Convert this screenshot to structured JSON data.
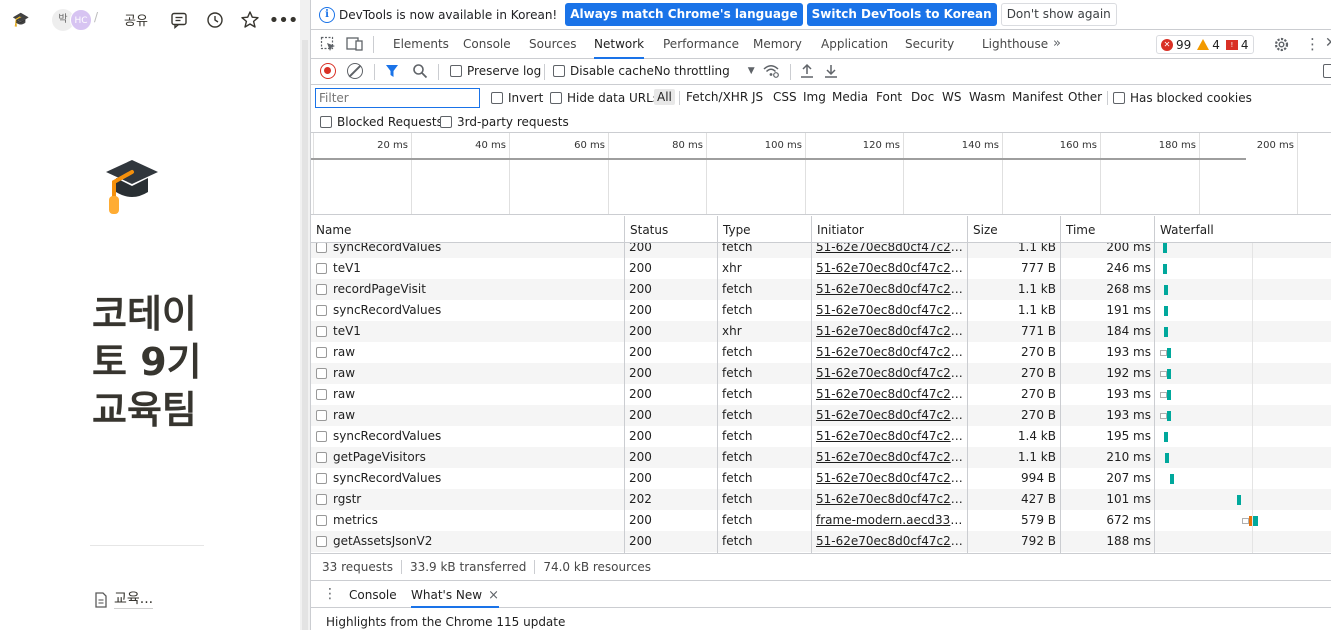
{
  "notion": {
    "page_icon_small": "🎓",
    "avatars": [
      "박",
      "HC"
    ],
    "share_label": "공유",
    "page_title": "코테이토 9기 교육팀",
    "subpage_label": "교육...",
    "icons": [
      "graduation-cap-icon",
      "comment-icon",
      "history-icon",
      "star-icon",
      "more-icon",
      "page-doc-icon"
    ]
  },
  "infobar": {
    "text": "DevTools is now available in Korean!",
    "btn_match": "Always match Chrome's language",
    "btn_switch": "Switch DevTools to Korean",
    "btn_dismiss": "Don't show again"
  },
  "tabs": [
    {
      "label": "Elements"
    },
    {
      "label": "Console"
    },
    {
      "label": "Sources"
    },
    {
      "label": "Network"
    },
    {
      "label": "Performance"
    },
    {
      "label": "Memory"
    },
    {
      "label": "Application"
    },
    {
      "label": "Security"
    },
    {
      "label": "Lighthouse"
    }
  ],
  "active_tab": "Network",
  "more_tabs": "»",
  "issues": {
    "errors": "99",
    "warnings": "4",
    "issues": "4"
  },
  "toolbar": {
    "preserve_log": "Preserve log",
    "disable_cache": "Disable cache",
    "throttling": "No throttling"
  },
  "filter": {
    "placeholder": "Filter",
    "invert": "Invert",
    "hide_data_urls": "Hide data URLs",
    "types": [
      "All",
      "Fetch/XHR",
      "JS",
      "CSS",
      "Img",
      "Media",
      "Font",
      "Doc",
      "WS",
      "Wasm",
      "Manifest",
      "Other"
    ],
    "has_blocked_cookies": "Has blocked cookies",
    "blocked_requests": "Blocked Requests",
    "third_party": "3rd-party requests"
  },
  "overview": {
    "ticks": [
      "20 ms",
      "40 ms",
      "60 ms",
      "80 ms",
      "100 ms",
      "120 ms",
      "140 ms",
      "160 ms",
      "180 ms",
      "200 ms"
    ]
  },
  "columns": [
    "Name",
    "Status",
    "Type",
    "Initiator",
    "Size",
    "Time",
    "Waterfall"
  ],
  "requests": [
    {
      "name": "syncRecordValues",
      "status": "200",
      "type": "fetch",
      "initiator": "51-62e70ec8d0cf47c2.js:1",
      "size": "1.1 kB",
      "time": "200 ms"
    },
    {
      "name": "teV1",
      "status": "200",
      "type": "xhr",
      "initiator": "51-62e70ec8d0cf47c2.js:1",
      "size": "777 B",
      "time": "246 ms"
    },
    {
      "name": "recordPageVisit",
      "status": "200",
      "type": "fetch",
      "initiator": "51-62e70ec8d0cf47c2.js:1",
      "size": "1.1 kB",
      "time": "268 ms"
    },
    {
      "name": "syncRecordValues",
      "status": "200",
      "type": "fetch",
      "initiator": "51-62e70ec8d0cf47c2.js:1",
      "size": "1.1 kB",
      "time": "191 ms"
    },
    {
      "name": "teV1",
      "status": "200",
      "type": "xhr",
      "initiator": "51-62e70ec8d0cf47c2.js:1",
      "size": "771 B",
      "time": "184 ms"
    },
    {
      "name": "raw",
      "status": "200",
      "type": "fetch",
      "initiator": "51-62e70ec8d0cf47c2.js:1",
      "size": "270 B",
      "time": "193 ms"
    },
    {
      "name": "raw",
      "status": "200",
      "type": "fetch",
      "initiator": "51-62e70ec8d0cf47c2.js:1",
      "size": "270 B",
      "time": "192 ms"
    },
    {
      "name": "raw",
      "status": "200",
      "type": "fetch",
      "initiator": "51-62e70ec8d0cf47c2.js:1",
      "size": "270 B",
      "time": "193 ms"
    },
    {
      "name": "raw",
      "status": "200",
      "type": "fetch",
      "initiator": "51-62e70ec8d0cf47c2.js:1",
      "size": "270 B",
      "time": "193 ms"
    },
    {
      "name": "syncRecordValues",
      "status": "200",
      "type": "fetch",
      "initiator": "51-62e70ec8d0cf47c2.js:1",
      "size": "1.4 kB",
      "time": "195 ms"
    },
    {
      "name": "getPageVisitors",
      "status": "200",
      "type": "fetch",
      "initiator": "51-62e70ec8d0cf47c2.js:1",
      "size": "1.1 kB",
      "time": "210 ms"
    },
    {
      "name": "syncRecordValues",
      "status": "200",
      "type": "fetch",
      "initiator": "51-62e70ec8d0cf47c2.js:1",
      "size": "994 B",
      "time": "207 ms"
    },
    {
      "name": "rgstr",
      "status": "202",
      "type": "fetch",
      "initiator": "51-62e70ec8d0cf47c2.js:1",
      "size": "427 B",
      "time": "101 ms"
    },
    {
      "name": "metrics",
      "status": "200",
      "type": "fetch",
      "initiator": "frame-modern.aecd3378.j...",
      "size": "579 B",
      "time": "672 ms"
    },
    {
      "name": "getAssetsJsonV2",
      "status": "200",
      "type": "fetch",
      "initiator": "51-62e70ec8d0cf47c2.js:1",
      "size": "792 B",
      "time": "188 ms"
    }
  ],
  "status": {
    "requests": "33 requests",
    "transferred": "33.9 kB transferred",
    "resources": "74.0 kB resources"
  },
  "drawer": {
    "tabs": [
      "Console",
      "What's New"
    ],
    "active": "What's New",
    "close": "×",
    "content": "Highlights from the Chrome 115 update"
  },
  "colors": {
    "accent": "#1a73e8",
    "error": "#d93025",
    "warning": "#f29900",
    "waterfall": "#00a89c"
  }
}
